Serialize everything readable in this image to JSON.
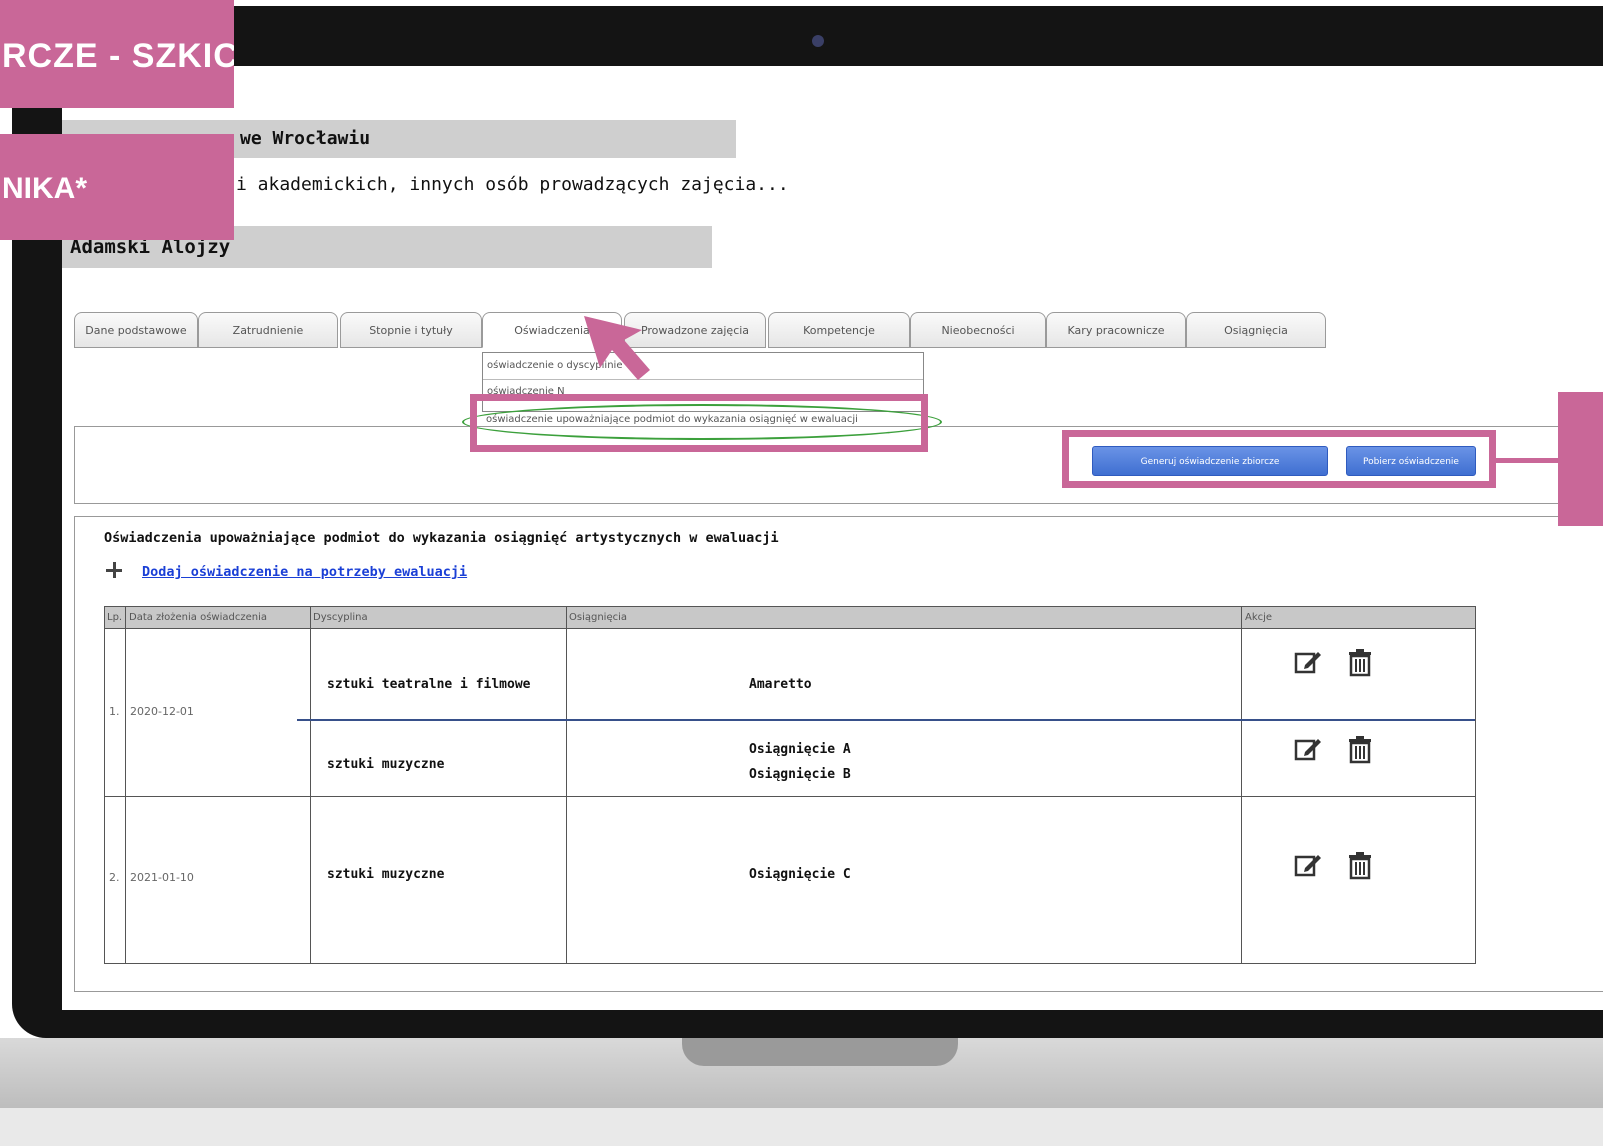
{
  "overlay": {
    "title": "RCZE - SZKIC",
    "subtitle": "NIKA*"
  },
  "header": {
    "university": "we Wrocławiu",
    "subtitle": "i akademickich, innych osób prowadzących zajęcia...",
    "person": "Adamski Alojzy"
  },
  "tabs": [
    {
      "label": "Dane podstawowe"
    },
    {
      "label": "Zatrudnienie"
    },
    {
      "label": "Stopnie i tytuły"
    },
    {
      "label": "Oświadczenia"
    },
    {
      "label": "Prowadzone zajęcia"
    },
    {
      "label": "Kompetencje"
    },
    {
      "label": "Nieobecności"
    },
    {
      "label": "Kary pracownicze"
    },
    {
      "label": "Osiągnięcia"
    }
  ],
  "dropdown": {
    "items": [
      "oświadczenie o dyscyplinie",
      "oświadczenie N",
      "oświadczenie upoważniające podmiot do wykazania osiągnięć w ewaluacji"
    ]
  },
  "toolbar": {
    "generate_label": "Generuj oświadczenie zbiorcze",
    "download_label": "Pobierz oświadczenie"
  },
  "section": {
    "title": "Oświadczenia upoważniające podmiot do wykazania osiągnięć artystycznych w ewaluacji",
    "add_link": "Dodaj oświadczenie na potrzeby ewaluacji"
  },
  "table": {
    "columns": [
      "Lp.",
      "Data złożenia oświadczenia",
      "Dyscyplina",
      "Osiągnięcia",
      "Akcje"
    ],
    "rows": [
      {
        "lp": "1.",
        "date": "2020-12-01",
        "entries": [
          {
            "discipline": "sztuki teatralne i filmowe",
            "achievements": [
              "Amaretto"
            ]
          },
          {
            "discipline": "sztuki muzyczne",
            "achievements": [
              "Osiągnięcie A",
              "Osiągnięcie B"
            ]
          }
        ]
      },
      {
        "lp": "2.",
        "date": "2021-01-10",
        "entries": [
          {
            "discipline": "sztuki muzyczne",
            "achievements": [
              "Osiągnięcie C"
            ]
          }
        ]
      }
    ]
  },
  "icons": [
    "edit-icon",
    "trash-icon",
    "plus-icon",
    "cursor-arrow-icon"
  ],
  "colors": {
    "accent_pink": "#c96798",
    "button_blue": "#3f6fd1",
    "link_blue": "#1a3fd6"
  }
}
